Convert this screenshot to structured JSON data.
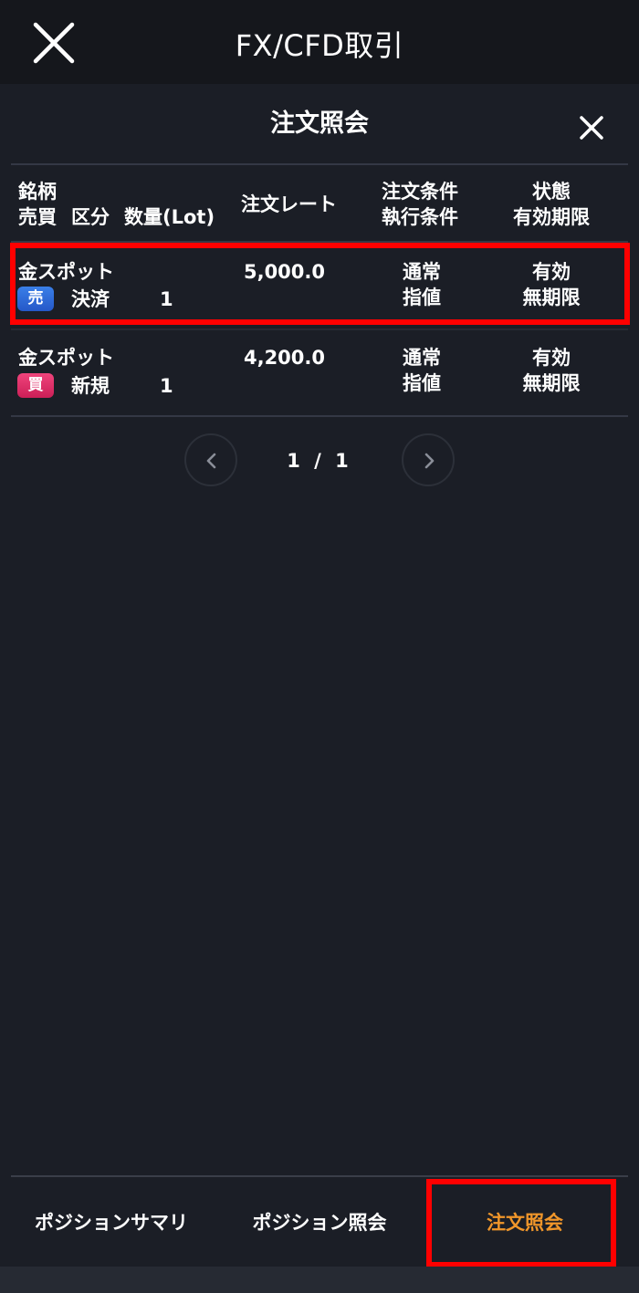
{
  "app": {
    "title": "FX/CFD取引",
    "close_icon": "close-icon"
  },
  "panel": {
    "title": "注文照会",
    "close_icon": "close-icon"
  },
  "table": {
    "headers": {
      "symbol": "銘柄",
      "side": "売買",
      "category": "区分",
      "quantity": "数量(Lot)",
      "rate": "注文レート",
      "order_condition": "注文条件",
      "exec_condition": "執行条件",
      "status": "状態",
      "expiry": "有効期限"
    },
    "rows": [
      {
        "symbol": "金スポット",
        "side": "売",
        "category": "決済",
        "quantity": "1",
        "rate": "5,000.0",
        "order_condition": "通常",
        "exec_condition": "指値",
        "status": "有効",
        "expiry": "無期限",
        "side_color": "#2f6bd8"
      },
      {
        "symbol": "金スポット",
        "side": "買",
        "category": "新規",
        "quantity": "1",
        "rate": "4,200.0",
        "order_condition": "通常",
        "exec_condition": "指値",
        "status": "有効",
        "expiry": "無期限",
        "side_color": "#e3326b"
      }
    ]
  },
  "pager": {
    "text": "1 / 1",
    "prev_icon": "chevron-left-icon",
    "next_icon": "chevron-right-icon"
  },
  "bottom_nav": {
    "items": [
      {
        "label": "ポジションサマリ",
        "active": false
      },
      {
        "label": "ポジション照会",
        "active": false
      },
      {
        "label": "注文照会",
        "active": true
      }
    ],
    "active_color": "#f0962a"
  },
  "colors": {
    "highlight": "#ff0000",
    "background": "#1b1e26"
  }
}
